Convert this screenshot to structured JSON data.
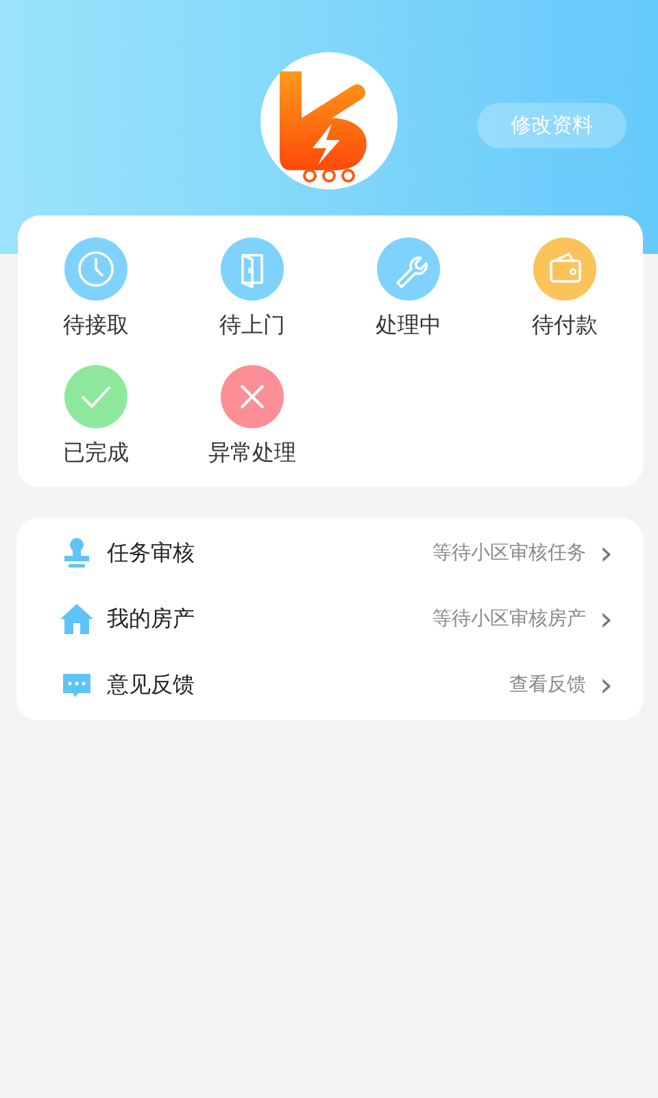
{
  "header": {
    "edit_button": "修改资料"
  },
  "orders": [
    {
      "kind": "clock",
      "label": "待接取",
      "color": "#7fd2fb"
    },
    {
      "kind": "door",
      "label": "待上门",
      "color": "#7fd2fb"
    },
    {
      "kind": "wrench",
      "label": "处理中",
      "color": "#7fd2fb"
    },
    {
      "kind": "wallet",
      "label": "待付款",
      "color": "#fbc35a"
    },
    {
      "kind": "check",
      "label": "已完成",
      "color": "#8ee89c"
    },
    {
      "kind": "cross",
      "label": "异常处理",
      "color": "#fb8f95"
    }
  ],
  "menu": [
    {
      "kind": "stamp",
      "label": "任务审核",
      "value": "等待小区审核任务",
      "chevron": "›"
    },
    {
      "kind": "house",
      "label": "我的房产",
      "value": "等待小区审核房产",
      "chevron": "›"
    },
    {
      "kind": "chat",
      "label": "意见反馈",
      "value": "查看反馈",
      "chevron": "›"
    }
  ]
}
